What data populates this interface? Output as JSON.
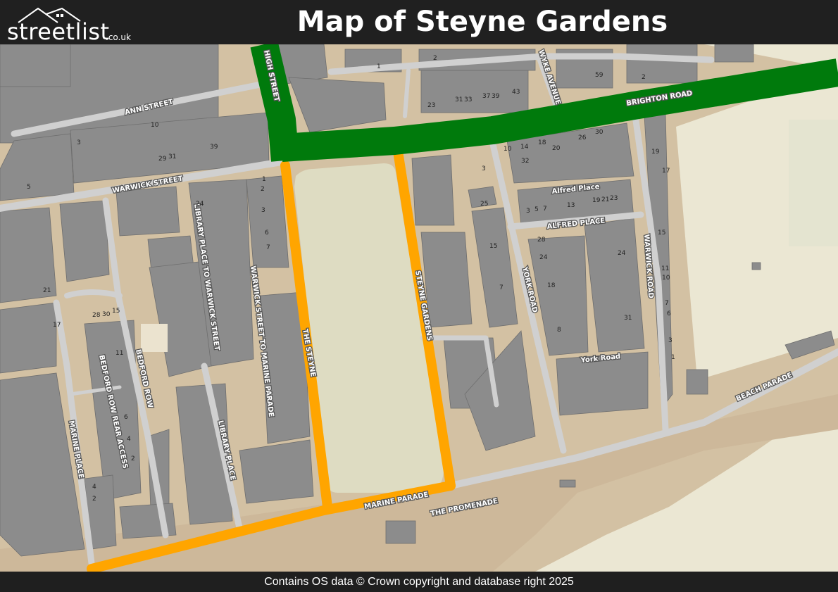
{
  "header": {
    "title": "Map of Steyne Gardens",
    "logo": {
      "brand": "streetlist",
      "domain": ".co.uk"
    }
  },
  "footer": {
    "attribution": "Contains OS data © Crown copyright and database right 2025"
  },
  "map": {
    "colors": {
      "land": "#d3c1a3",
      "building": "#8c8c8c",
      "minor_road": "#d0d0d0",
      "a_road": "#007a0c",
      "highlight_road": "#ffa500",
      "park": "#dedcc2",
      "beach": "#cdb89a",
      "sea": "#ebe7d3"
    },
    "street_labels": {
      "high_street": "HIGH STREET",
      "ann_street": "ANN STREET",
      "warwick_street": "WARWICK STREET",
      "brighton_road": "BRIGHTON ROAD",
      "wyke_avenue": "WYKE AVENUE",
      "library_place_to_warwick_street": "LIBRARY PLACE TO WARWICK STREET",
      "warwick_street_to_marine_parade": "WARWICK STREET TO MARINE PARADE",
      "the_steyne": "THE STEYNE",
      "steyne_gardens": "STEYNE GARDENS",
      "alfred_place_lower": "Alfred Place",
      "alfred_place_upper": "ALFRED PLACE",
      "york_road_upper": "YORK ROAD",
      "york_road_lower": "York Road",
      "warwick_road": "WARWICK ROAD",
      "bedford_row": "BEDFORD ROW",
      "bedford_row_rear_access": "BEDFORD ROW REAR ACCESS",
      "marine_place": "MARINE PLACE",
      "library_place": "LIBRARY PLACE",
      "marine_parade": "MARINE PARADE",
      "the_promenade": "THE PROMENADE",
      "beach_parade": "BEACH PARADE"
    },
    "house_numbers": [
      "1",
      "2",
      "2",
      "59",
      "23",
      "31",
      "33",
      "37",
      "39",
      "43",
      "10",
      "3",
      "29",
      "31",
      "39",
      "5",
      "24",
      "1",
      "2",
      "3",
      "6",
      "7",
      "10",
      "14",
      "18",
      "20",
      "26",
      "30",
      "32",
      "3",
      "25",
      "3",
      "5",
      "7",
      "13",
      "19",
      "21",
      "23",
      "15",
      "7",
      "28",
      "24",
      "18",
      "8",
      "19",
      "17",
      "15",
      "11",
      "10",
      "7",
      "6",
      "3",
      "1",
      "24",
      "31",
      "21",
      "17",
      "28",
      "30",
      "15",
      "11",
      "6",
      "4",
      "2",
      "4",
      "2"
    ]
  }
}
